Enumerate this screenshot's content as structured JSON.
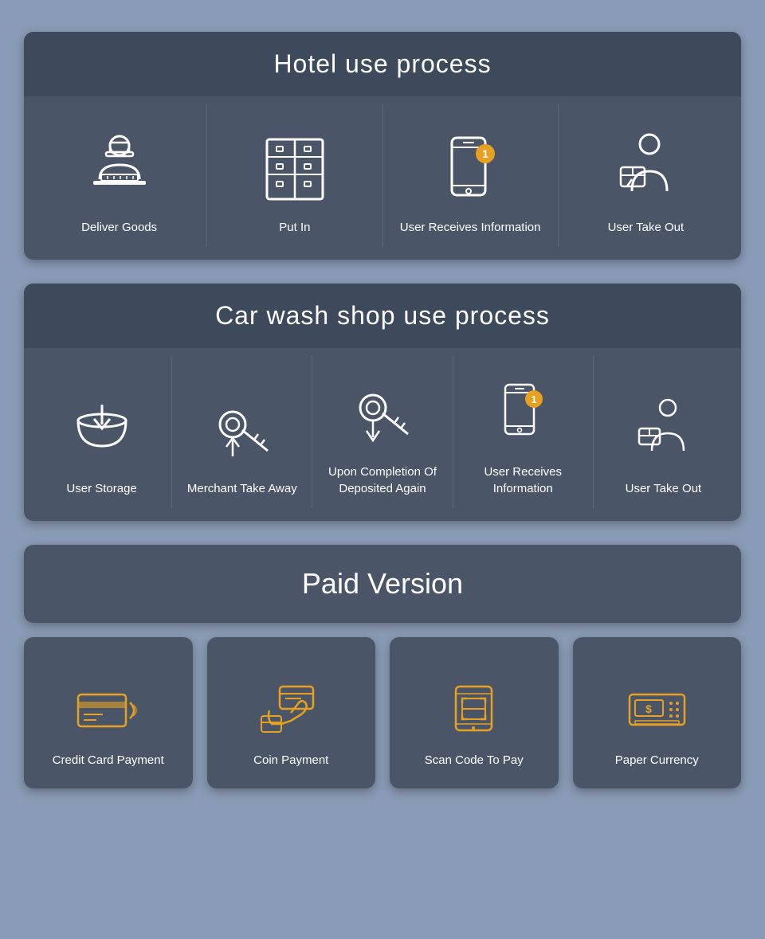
{
  "hotel": {
    "title": "Hotel use process",
    "items": [
      {
        "label": "Deliver Goods"
      },
      {
        "label": "Put In"
      },
      {
        "label": "User Receives Information"
      },
      {
        "label": "User Take Out"
      }
    ]
  },
  "carwash": {
    "title": "Car wash shop use process",
    "items": [
      {
        "label": "User Storage"
      },
      {
        "label": "Merchant Take Away"
      },
      {
        "label": "Upon Completion Of Deposited Again"
      },
      {
        "label": "User Receives Information"
      },
      {
        "label": "User Take Out"
      }
    ]
  },
  "paid": {
    "title": "Paid Version",
    "items": [
      {
        "label": "Credit Card Payment"
      },
      {
        "label": "Coin Payment"
      },
      {
        "label": "Scan Code To Pay"
      },
      {
        "label": "Paper Currency"
      }
    ]
  }
}
